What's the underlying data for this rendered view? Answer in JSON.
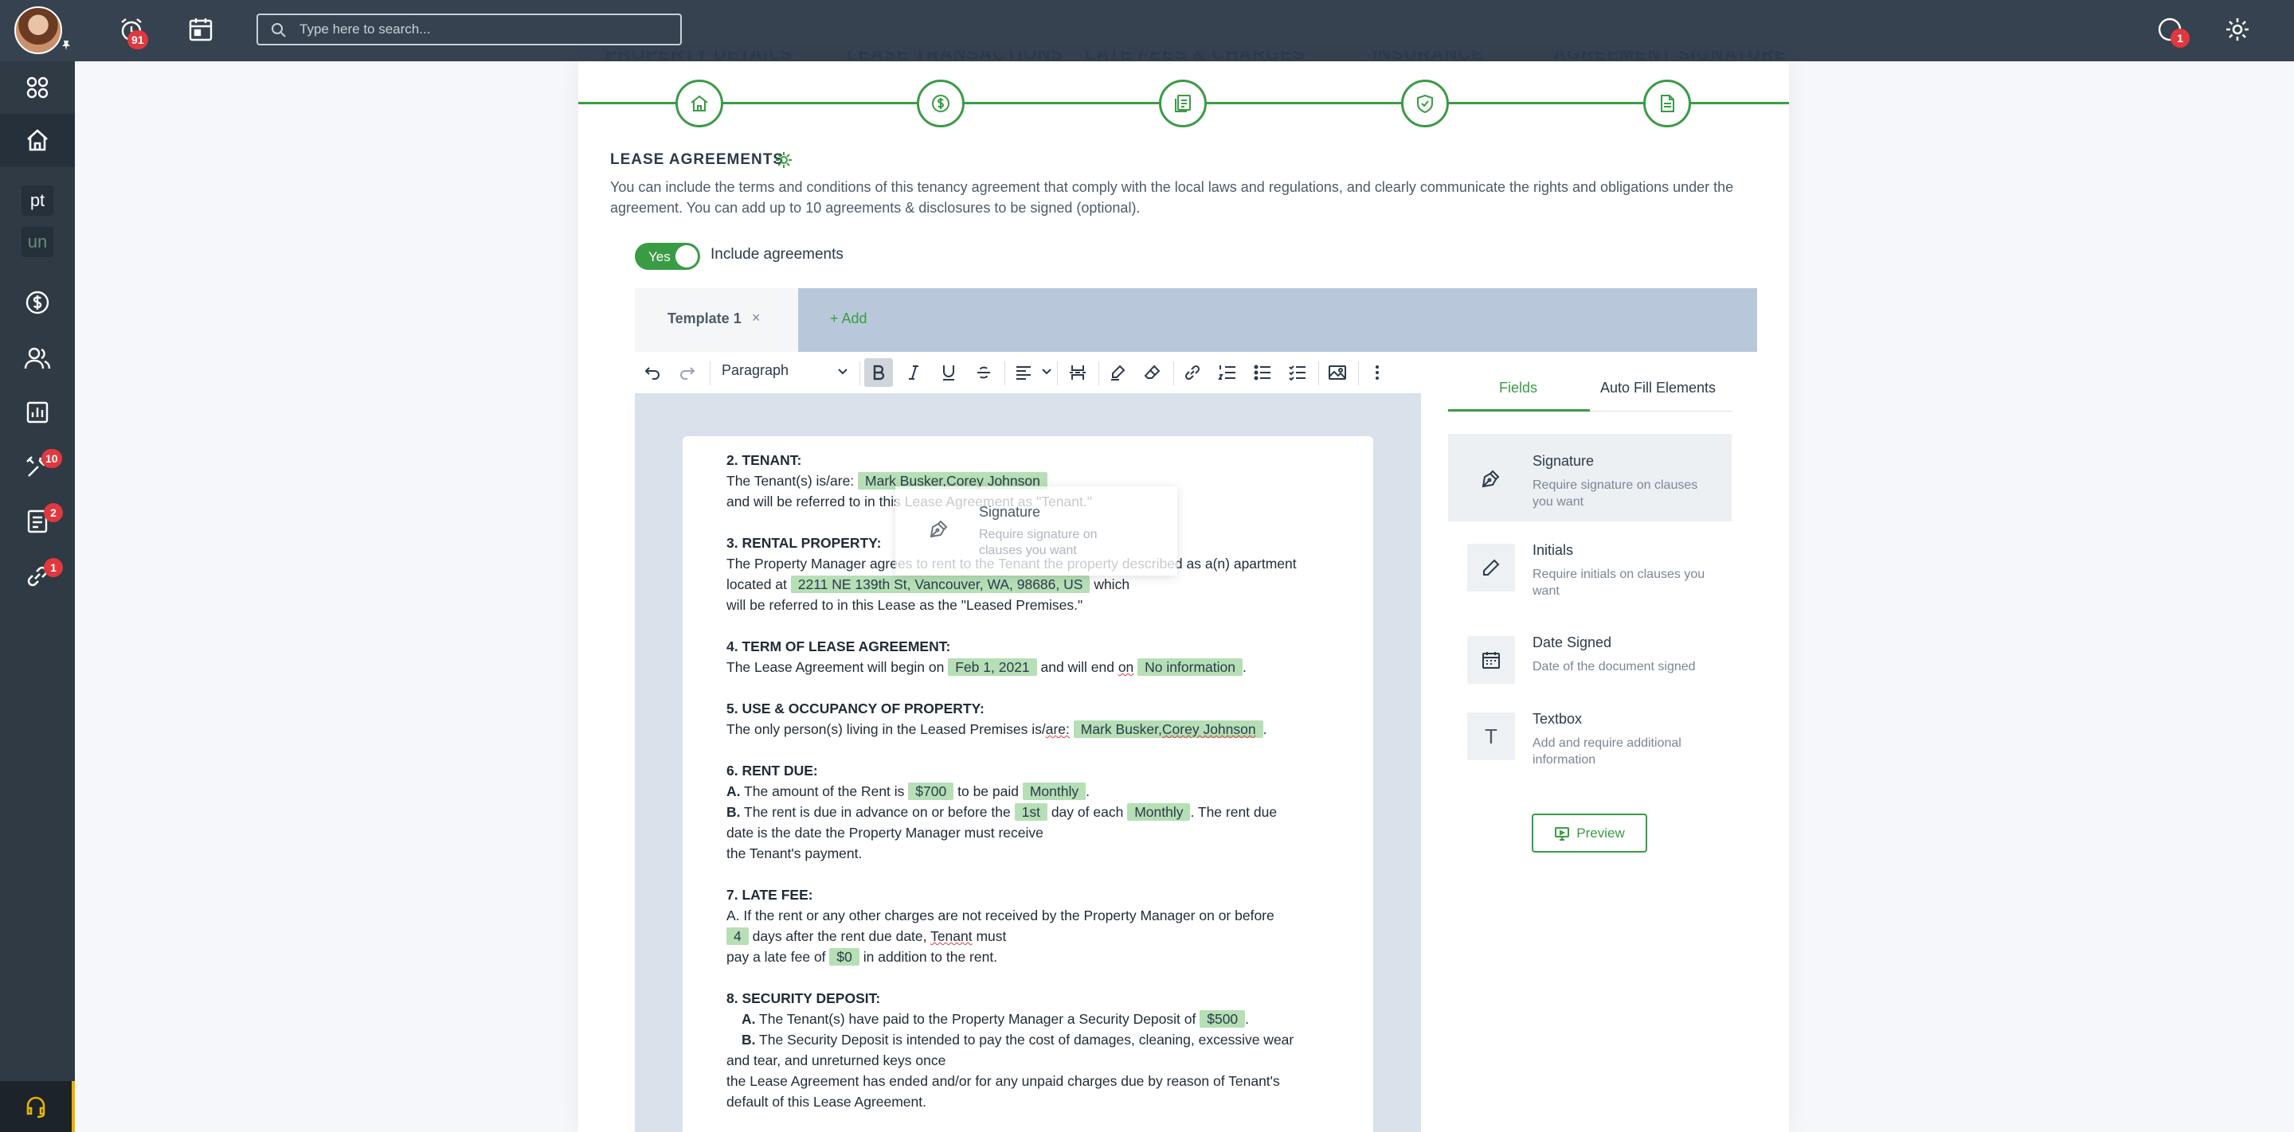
{
  "topbar": {
    "notifications_count": "91",
    "search_placeholder": "Type here to search...",
    "messages_count": "1"
  },
  "leftnav": {
    "chip1": "pt",
    "chip2": "un",
    "tools_badge": "10",
    "docs_badge": "2",
    "links_badge": "1"
  },
  "stepper": {
    "steps": [
      "PROPERTY DETAILS",
      "LEASE TRANSACTIONS",
      "LATE FEES & CHARGES",
      "INSURANCE",
      "AGREEMENT SIGNATURE"
    ]
  },
  "section": {
    "title": "LEASE AGREEMENTS",
    "description": "You can include the terms and conditions of this tenancy agreement that comply with the local laws and regulations, and clearly communicate the rights and obligations under the agreement. You can add up to 10 agreements & disclosures to be signed (optional).",
    "toggle_label": "Yes",
    "include_label": "Include agreements"
  },
  "tabs": {
    "template_label": "Template 1",
    "close": "×",
    "add_label": "+ Add"
  },
  "toolbar": {
    "paragraph": "Paragraph"
  },
  "document": {
    "tenant_heading": "2. TENANT:",
    "tenant_line1_pre": "The Tenant(s) is/are:",
    "tenant_names": "Mark Busker,Corey Johnson",
    "tenant_line2": "and will be referred to in this Lease Agreement as \"Tenant.\"",
    "rental_heading": "3. RENTAL PROPERTY:",
    "rental_line1": "The Property Manager agrees to rent to the Tenant the property described as a(n) apartment",
    "rental_line2_pre": "located at",
    "address": "2211 NE 139th St, Vancouver, WA, 98686, US",
    "rental_line2_post": "which",
    "rental_line3": "will be referred to in this Lease as the \"Leased Premises.\"",
    "term_heading": "4. TERM OF LEASE AGREEMENT:",
    "term_pre": "The Lease Agreement will begin on",
    "start_date": "Feb 1, 2021",
    "term_mid": "and will end",
    "term_on": "on",
    "end_date": "No information",
    "use_heading": "5. USE & OCCUPANCY OF PROPERTY:",
    "use_pre": "The only person(s) living in the Leased Premises is/",
    "use_are": "are:",
    "use_names_a": "Mark Busker",
    "use_names_b": "Corey Johnson",
    "rent_heading": "6. RENT DUE:",
    "rent_a_label": "A.",
    "rent_a_pre": "The amount of the Rent is",
    "rent_amount": "$700",
    "rent_a_mid": "to be paid",
    "rent_freq": "Monthly",
    "rent_b_label": "B.",
    "rent_b_pre": "The rent is due in advance on or before the",
    "rent_day": "1st",
    "rent_b_mid": "day of each",
    "rent_b_freq": "Monthly",
    "rent_b_post": ". The rent due",
    "rent_b_line2": "date is the date the Property Manager must receive",
    "rent_b_line3": "the Tenant's payment.",
    "late_heading": "7. LATE FEE:",
    "late_line1": "A. If the rent or any other charges are not received by the Property Manager on or before",
    "late_days": "4",
    "late_line2_mid": "days after the rent due date,",
    "late_tenant": "Tenant",
    "late_must": "must",
    "late_line3_pre": "pay a late fee of",
    "late_fee": "$0",
    "late_line3_post": "in addition to the rent.",
    "deposit_heading": "8. SECURITY DEPOSIT:",
    "deposit_a_label": "A.",
    "deposit_a_pre": "The Tenant(s) have paid to the Property Manager a Security Deposit of",
    "deposit_amount": "$500",
    "deposit_b_label": "B.",
    "deposit_b_line1": "The Security Deposit is intended to pay the cost of damages, cleaning, excessive wear",
    "deposit_b_line2": "and tear, and unreturned keys once",
    "deposit_b_line3": "the Lease Agreement has ended and/or for any unpaid charges due by reason of Tenant's",
    "deposit_b_line4": "default of this Lease Agreement."
  },
  "drag_ghost": {
    "title": "Signature",
    "desc": "Require signature on clauses you want"
  },
  "panel": {
    "tab_fields": "Fields",
    "tab_autofill": "Auto Fill Elements",
    "fields": [
      {
        "title": "Signature",
        "desc": "Require signature on clauses you want",
        "icon": "pen-nib-icon"
      },
      {
        "title": "Initials",
        "desc": "Require initials on clauses you want",
        "icon": "pencil-icon"
      },
      {
        "title": "Date Signed",
        "desc": "Date of the document signed",
        "icon": "calendar-icon"
      },
      {
        "title": "Textbox",
        "desc": "Add and require additional information",
        "icon": "text-icon"
      }
    ],
    "textbox_glyph": "T",
    "preview_label": "Preview"
  },
  "colors": {
    "accent": "#3a9b45",
    "topbar": "#36424f",
    "nav": "#2f3a44",
    "badge": "#e0383e",
    "token": "#b6dfb6"
  }
}
